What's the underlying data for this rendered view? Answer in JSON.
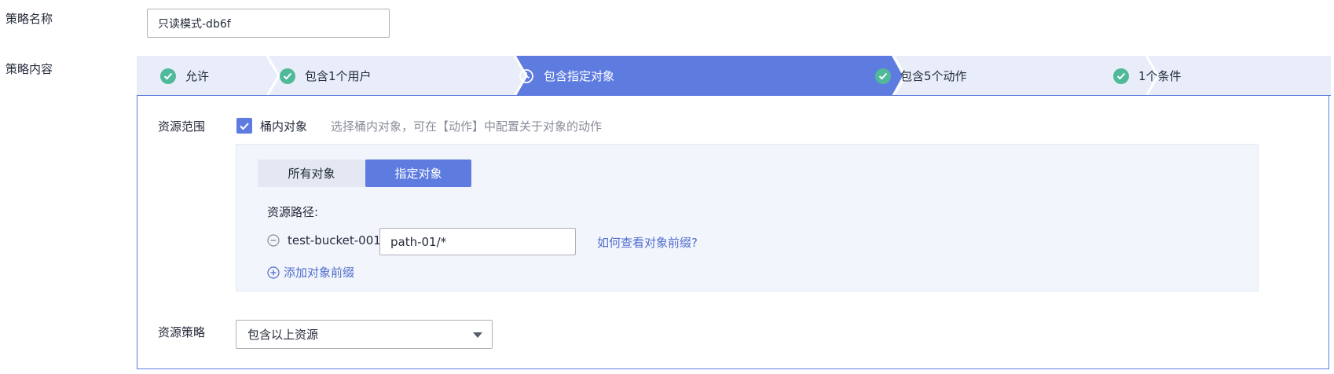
{
  "policy_name": {
    "label": "策略名称",
    "value": "只读模式-db6f"
  },
  "policy_content": {
    "label": "策略内容"
  },
  "steps": [
    {
      "label": "允许",
      "status": "done"
    },
    {
      "label": "包含1个用户",
      "status": "done"
    },
    {
      "label": "包含指定对象",
      "status": "current"
    },
    {
      "label": "包含5个动作",
      "status": "done"
    },
    {
      "label": "1个条件",
      "status": "done"
    }
  ],
  "resource_scope": {
    "label": "资源范围",
    "checkbox_label": "桶内对象",
    "checked": true,
    "hint": "选择桶内对象，可在【动作】中配置关于对象的动作",
    "tabs": [
      {
        "label": "所有对象",
        "selected": false
      },
      {
        "label": "指定对象",
        "selected": true
      }
    ],
    "path_label": "资源路径:",
    "bucket_name": "test-bucket-001",
    "path_value": "path-01/*",
    "help_link": "如何查看对象前缀?",
    "add_prefix_label": "添加对象前缀"
  },
  "resource_policy": {
    "label": "资源策略",
    "selected_option": "包含以上资源"
  },
  "colors": {
    "accent": "#5e7ce0",
    "step_bg": "#e8edf9",
    "success": "#50b99a",
    "link": "#526ecc"
  }
}
